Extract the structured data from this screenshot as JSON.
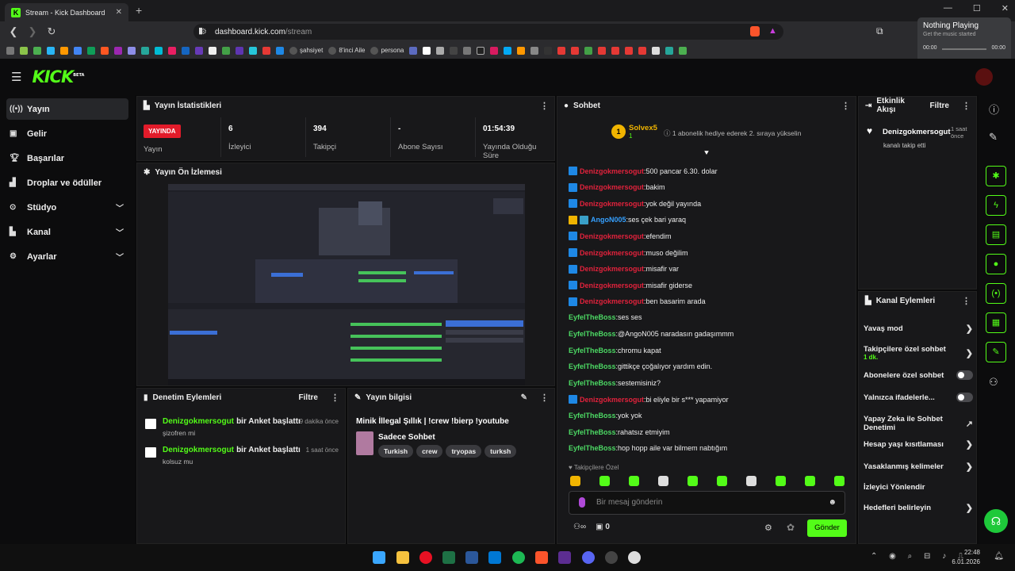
{
  "browser": {
    "tab_title": "Stream - Kick Dashboard",
    "url_host": "dashboard.kick.com",
    "url_path": "/stream",
    "new_tab": "+",
    "window_controls": [
      "—",
      "☐",
      "✕"
    ],
    "bookmarks": [
      {
        "label": "şahsiyet"
      },
      {
        "label": "8'inci Aile"
      },
      {
        "label": "persona"
      }
    ]
  },
  "media": {
    "title": "Nothing Playing",
    "subtitle": "Get the music started",
    "time_start": "00:00",
    "time_end": "00:00"
  },
  "brand": {
    "logo": "KICK",
    "beta": "BETA",
    "accent": "#53fc18"
  },
  "sidebar": {
    "items": [
      {
        "label": "Yayın",
        "icon": "broadcast-icon",
        "active": true,
        "chevron": false
      },
      {
        "label": "Gelir",
        "icon": "wallet-icon",
        "active": false,
        "chevron": false
      },
      {
        "label": "Başarılar",
        "icon": "trophy-icon",
        "active": false,
        "chevron": false
      },
      {
        "label": "Droplar ve ödüller",
        "icon": "gift-icon",
        "active": false,
        "chevron": false
      },
      {
        "label": "Stüdyo",
        "icon": "studio-icon",
        "active": false,
        "chevron": true
      },
      {
        "label": "Kanal",
        "icon": "channel-icon",
        "active": false,
        "chevron": true
      },
      {
        "label": "Ayarlar",
        "icon": "gear-icon",
        "active": false,
        "chevron": true
      }
    ]
  },
  "stats": {
    "title": "Yayın İstatistikleri",
    "live_badge": "YAYINDA",
    "live_label": "Yayın",
    "items": [
      {
        "value": "6",
        "label": "İzleyici"
      },
      {
        "value": "394",
        "label": "Takipçi"
      },
      {
        "value": "-",
        "label": "Abone Sayısı"
      },
      {
        "value": "01:54:39",
        "label": "Yayında Olduğu Süre"
      }
    ]
  },
  "preview": {
    "title": "Yayın Ön İzlemesi"
  },
  "moderation": {
    "title": "Denetim Eylemleri",
    "filter": "Filtre",
    "rows": [
      {
        "user": "Denizgokmersogut",
        "action": "bir Anket başlattı",
        "time": "9 dakika önce",
        "sub": "şizofren mi"
      },
      {
        "user": "Denizgokmersogut",
        "action": "bir Anket başlattı",
        "time": "1 saat önce",
        "sub": "kolsuz mu"
      }
    ]
  },
  "stream_info": {
    "title": "Yayın bilgisi",
    "stream_title": "Minik İllegal Şıllık | !crew !bierp !youtube",
    "category": "Sadece Sohbet",
    "tags": [
      "Turkish",
      "crew",
      "tryopas",
      "turksh"
    ]
  },
  "chat": {
    "title": "Sohbet",
    "top_gifter": "Solvex5",
    "top_gifter_count": "1",
    "top_rank": "1",
    "gift_note": "1 abonelik hediye ederek 2. sıraya yükselin",
    "messages": [
      {
        "user": "Denizgokmersogut",
        "text": "500 pancar 6.30. dolar",
        "color": "red",
        "badge": "badge"
      },
      {
        "user": "Denizgokmersogut",
        "text": "bakim",
        "color": "red",
        "badge": "badge"
      },
      {
        "user": "Denizgokmersogut",
        "text": "yok değil yayında",
        "color": "red",
        "badge": "badge"
      },
      {
        "user": "AngoN005",
        "text": "ses çek bari yaraq",
        "color": "blu",
        "badge": "crown"
      },
      {
        "user": "Denizgokmersogut",
        "text": "efendim",
        "color": "red",
        "badge": "badge"
      },
      {
        "user": "Denizgokmersogut",
        "text": "muso değilim",
        "color": "red",
        "badge": "badge"
      },
      {
        "user": "Denizgokmersogut",
        "text": "misafir var",
        "color": "red",
        "badge": "badge"
      },
      {
        "user": "Denizgokmersogut",
        "text": "misafir giderse",
        "color": "red",
        "badge": "badge"
      },
      {
        "user": "Denizgokmersogut",
        "text": "ben basarim arada",
        "color": "red",
        "badge": "badge"
      },
      {
        "user": "EyfelTheBoss",
        "text": "ses ses",
        "color": "grn",
        "badge": ""
      },
      {
        "user": "EyfelTheBoss",
        "text": "@AngoN005 naradasın gadaşımmm",
        "color": "grn",
        "badge": ""
      },
      {
        "user": "EyfelTheBoss",
        "text": "chromu kapat",
        "color": "grn",
        "badge": ""
      },
      {
        "user": "EyfelTheBoss",
        "text": "gittikçe çoğalıyor yardım edin.",
        "color": "grn",
        "badge": ""
      },
      {
        "user": "EyfelTheBoss",
        "text": "sestemisiniz?",
        "color": "grn",
        "badge": ""
      },
      {
        "user": "Denizgokmersogut",
        "text": "bi eliyle bir s*** yapamiyor",
        "color": "red",
        "badge": "badge"
      },
      {
        "user": "EyfelTheBoss",
        "text": "yok yok",
        "color": "grn",
        "badge": ""
      },
      {
        "user": "EyfelTheBoss",
        "text": "rahatsız etmiyim",
        "color": "grn",
        "badge": ""
      },
      {
        "user": "EyfelTheBoss",
        "text": "hop hopp aile var bilmem nabtığım",
        "color": "grn",
        "badge": ""
      }
    ],
    "followers_only": "Takipçilere Özel",
    "placeholder": "Bir mesaj gönderin",
    "send": "Gönder",
    "count": "0"
  },
  "activity": {
    "title": "Etkinlik Akışı",
    "filter": "Filtre",
    "event_user": "Denizgokmersogut",
    "event_text": "kanalı takip etti",
    "event_time": "1 saat önce"
  },
  "actions": {
    "title": "Kanal Eylemleri",
    "items": [
      {
        "label": "Yavaş mod",
        "sub": "",
        "ctrl": "chevron"
      },
      {
        "label": "Takipçilere özel sohbet",
        "sub": "1 dk.",
        "ctrl": "chevron"
      },
      {
        "label": "Abonelere özel sohbet",
        "sub": "",
        "ctrl": "toggle"
      },
      {
        "label": "Yalnızca ifadelerle...",
        "sub": "",
        "ctrl": "toggle"
      },
      {
        "label": "Yapay Zeka ile Sohbet Denetimi",
        "sub": "",
        "ctrl": "link"
      },
      {
        "label": "Hesap yaşı kısıtlaması",
        "sub": "",
        "ctrl": "chevron"
      },
      {
        "label": "Yasaklanmış kelimeler",
        "sub": "",
        "ctrl": "chevron"
      },
      {
        "label": "İzleyici Yönlendir",
        "sub": "",
        "ctrl": ""
      },
      {
        "label": "Hedefleri belirleyin",
        "sub": "",
        "ctrl": "chevron"
      }
    ]
  },
  "taskbar": {
    "time": "22:48",
    "date": "6.01.2026"
  }
}
